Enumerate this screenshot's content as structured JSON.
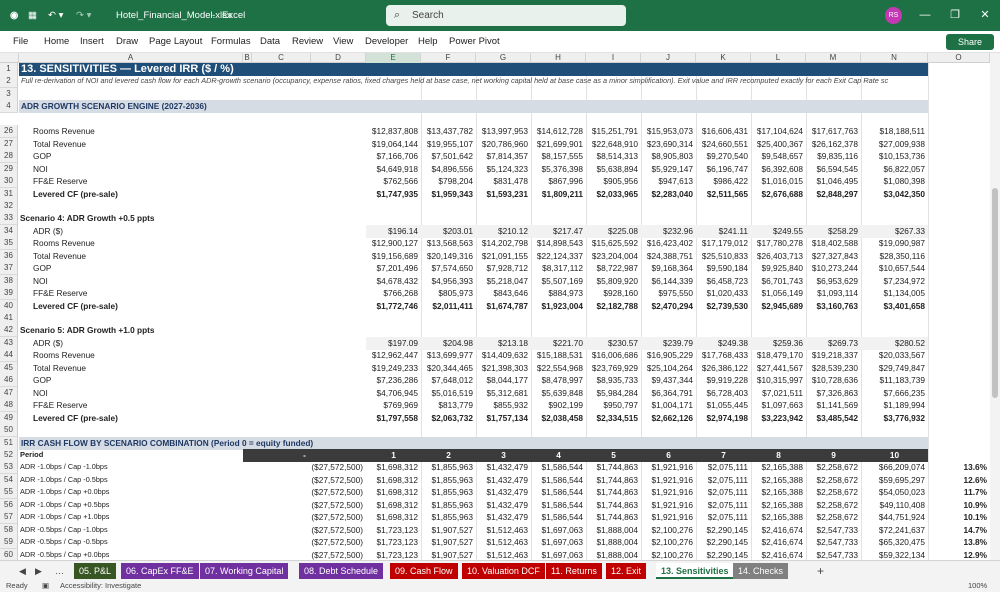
{
  "app": {
    "file_title": "Hotel_Financial_Model.xlsx",
    "app_name": "Excel",
    "search_placeholder": "Search",
    "avatar": "RS"
  },
  "menu": [
    "File",
    "Home",
    "Insert",
    "Draw",
    "Page Layout",
    "Formulas",
    "Data",
    "Review",
    "View",
    "Developer",
    "Help",
    "Power Pivot"
  ],
  "share_label": "Share",
  "columns": [
    "A",
    "B",
    "C",
    "D",
    "E",
    "F",
    "G",
    "H",
    "I",
    "J",
    "K",
    "L",
    "M",
    "N",
    "O"
  ],
  "sheet_title": "13. SENSITIVITIES — Levered IRR ($ / %)",
  "note": "Full re-derivation of NOI and levered cash flow for each ADR-growth scenario (occupancy, expense ratios, fixed charges held at base case, net working capital held at base case as a minor simplification). Exit value and IRR recomputed exactly for each Exit Cap Rate sc",
  "section1": "ADR GROWTH SCENARIO ENGINE (2027-2036)",
  "section2": "IRR CASH FLOW BY SCENARIO COMBINATION (Period 0 = equity funded)",
  "block1": [
    {
      "row": "26",
      "label": "Rooms Revenue",
      "vals": [
        "$12,837,808",
        "$13,437,782",
        "$13,997,953",
        "$14,612,728",
        "$15,251,791",
        "$15,953,073",
        "$16,606,431",
        "$17,104,624",
        "$17,617,763",
        "$18,188,511"
      ]
    },
    {
      "row": "27",
      "label": "Total Revenue",
      "vals": [
        "$19,064,144",
        "$19,955,107",
        "$20,786,960",
        "$21,699,901",
        "$22,648,910",
        "$23,690,314",
        "$24,660,551",
        "$25,400,367",
        "$26,162,378",
        "$27,009,938"
      ]
    },
    {
      "row": "28",
      "label": "GOP",
      "vals": [
        "$7,166,706",
        "$7,501,642",
        "$7,814,357",
        "$8,157,555",
        "$8,514,313",
        "$8,905,803",
        "$9,270,540",
        "$9,548,657",
        "$9,835,116",
        "$10,153,736"
      ]
    },
    {
      "row": "29",
      "label": "NOI",
      "vals": [
        "$4,649,918",
        "$4,896,556",
        "$5,124,323",
        "$5,376,398",
        "$5,638,894",
        "$5,929,147",
        "$6,196,747",
        "$6,392,608",
        "$6,594,545",
        "$6,822,057"
      ]
    },
    {
      "row": "30",
      "label": "FF&E Reserve",
      "vals": [
        "$762,566",
        "$798,204",
        "$831,478",
        "$867,996",
        "$905,956",
        "$947,613",
        "$986,422",
        "$1,016,015",
        "$1,046,495",
        "$1,080,398"
      ]
    },
    {
      "row": "31",
      "label": "Levered CF (pre-sale)",
      "bold": true,
      "vals": [
        "$1,747,935",
        "$1,959,343",
        "$1,593,231",
        "$1,809,211",
        "$2,033,965",
        "$2,283,040",
        "$2,511,565",
        "$2,676,688",
        "$2,848,297",
        "$3,042,350"
      ]
    }
  ],
  "scenario4": "Scenario 4: ADR Growth +0.5 ppts",
  "block2": [
    {
      "row": "34",
      "label": "ADR ($)",
      "input": true,
      "vals": [
        "$196.14",
        "$203.01",
        "$210.12",
        "$217.47",
        "$225.08",
        "$232.96",
        "$241.11",
        "$249.55",
        "$258.29",
        "$267.33"
      ]
    },
    {
      "row": "35",
      "label": "Rooms Revenue",
      "vals": [
        "$12,900,127",
        "$13,568,563",
        "$14,202,798",
        "$14,898,543",
        "$15,625,592",
        "$16,423,402",
        "$17,179,012",
        "$17,780,278",
        "$18,402,588",
        "$19,090,987"
      ]
    },
    {
      "row": "36",
      "label": "Total Revenue",
      "vals": [
        "$19,156,689",
        "$20,149,316",
        "$21,091,155",
        "$22,124,337",
        "$23,204,004",
        "$24,388,751",
        "$25,510,833",
        "$26,403,713",
        "$27,327,843",
        "$28,350,116"
      ]
    },
    {
      "row": "37",
      "label": "GOP",
      "vals": [
        "$7,201,496",
        "$7,574,650",
        "$7,928,712",
        "$8,317,112",
        "$8,722,987",
        "$9,168,364",
        "$9,590,184",
        "$9,925,840",
        "$10,273,244",
        "$10,657,544"
      ]
    },
    {
      "row": "38",
      "label": "NOI",
      "vals": [
        "$4,678,432",
        "$4,956,393",
        "$5,218,047",
        "$5,507,169",
        "$5,809,920",
        "$6,144,339",
        "$6,458,723",
        "$6,701,743",
        "$6,953,629",
        "$7,234,972"
      ]
    },
    {
      "row": "39",
      "label": "FF&E Reserve",
      "vals": [
        "$766,268",
        "$805,973",
        "$843,646",
        "$884,973",
        "$928,160",
        "$975,550",
        "$1,020,433",
        "$1,056,149",
        "$1,093,114",
        "$1,134,005"
      ]
    },
    {
      "row": "40",
      "label": "Levered CF (pre-sale)",
      "bold": true,
      "vals": [
        "$1,772,746",
        "$2,011,411",
        "$1,674,787",
        "$1,923,004",
        "$2,182,788",
        "$2,470,294",
        "$2,739,530",
        "$2,945,689",
        "$3,160,763",
        "$3,401,658"
      ]
    }
  ],
  "scenario5": "Scenario 5: ADR Growth +1.0 ppts",
  "block3": [
    {
      "row": "43",
      "label": "ADR ($)",
      "input": true,
      "vals": [
        "$197.09",
        "$204.98",
        "$213.18",
        "$221.70",
        "$230.57",
        "$239.79",
        "$249.38",
        "$259.36",
        "$269.73",
        "$280.52"
      ]
    },
    {
      "row": "44",
      "label": "Rooms Revenue",
      "vals": [
        "$12,962,447",
        "$13,699,977",
        "$14,409,632",
        "$15,188,531",
        "$16,006,686",
        "$16,905,229",
        "$17,768,433",
        "$18,479,170",
        "$19,218,337",
        "$20,033,567"
      ]
    },
    {
      "row": "45",
      "label": "Total Revenue",
      "vals": [
        "$19,249,233",
        "$20,344,465",
        "$21,398,303",
        "$22,554,968",
        "$23,769,929",
        "$25,104,264",
        "$26,386,122",
        "$27,441,567",
        "$28,539,230",
        "$29,749,847"
      ]
    },
    {
      "row": "46",
      "label": "GOP",
      "vals": [
        "$7,236,286",
        "$7,648,012",
        "$8,044,177",
        "$8,478,997",
        "$8,935,733",
        "$9,437,344",
        "$9,919,228",
        "$10,315,997",
        "$10,728,636",
        "$11,183,739"
      ]
    },
    {
      "row": "47",
      "label": "NOI",
      "vals": [
        "$4,706,945",
        "$5,016,519",
        "$5,312,681",
        "$5,639,848",
        "$5,984,284",
        "$6,364,791",
        "$6,728,403",
        "$7,021,511",
        "$7,326,863",
        "$7,666,235"
      ]
    },
    {
      "row": "48",
      "label": "FF&E Reserve",
      "vals": [
        "$769,969",
        "$813,779",
        "$855,932",
        "$902,199",
        "$950,797",
        "$1,004,171",
        "$1,055,445",
        "$1,097,663",
        "$1,141,569",
        "$1,189,994"
      ]
    },
    {
      "row": "49",
      "label": "Levered CF (pre-sale)",
      "bold": true,
      "vals": [
        "$1,797,558",
        "$2,063,732",
        "$1,757,134",
        "$2,038,458",
        "$2,334,515",
        "$2,662,126",
        "$2,974,198",
        "$3,223,942",
        "$3,485,542",
        "$3,776,932"
      ]
    }
  ],
  "irr_header": {
    "label": "Period",
    "periods": [
      "-",
      "1",
      "2",
      "3",
      "4",
      "5",
      "6",
      "7",
      "8",
      "9",
      "10"
    ]
  },
  "irr_rows": [
    {
      "row": "53",
      "label": "ADR -1.0bps / Cap -1.0bps",
      "vals": [
        "($27,572,500)",
        "$1,698,312",
        "$1,855,963",
        "$1,432,479",
        "$1,586,544",
        "$1,744,863",
        "$1,921,916",
        "$2,075,111",
        "$2,165,388",
        "$2,258,672",
        "$66,209,074"
      ],
      "irr": "13.6%"
    },
    {
      "row": "54",
      "label": "ADR -1.0bps / Cap -0.5bps",
      "vals": [
        "($27,572,500)",
        "$1,698,312",
        "$1,855,963",
        "$1,432,479",
        "$1,586,544",
        "$1,744,863",
        "$1,921,916",
        "$2,075,111",
        "$2,165,388",
        "$2,258,672",
        "$59,695,297"
      ],
      "irr": "12.6%"
    },
    {
      "row": "55",
      "label": "ADR -1.0bps / Cap +0.0bps",
      "vals": [
        "($27,572,500)",
        "$1,698,312",
        "$1,855,963",
        "$1,432,479",
        "$1,586,544",
        "$1,744,863",
        "$1,921,916",
        "$2,075,111",
        "$2,165,388",
        "$2,258,672",
        "$54,050,023"
      ],
      "irr": "11.7%"
    },
    {
      "row": "56",
      "label": "ADR -1.0bps / Cap +0.5bps",
      "vals": [
        "($27,572,500)",
        "$1,698,312",
        "$1,855,963",
        "$1,432,479",
        "$1,586,544",
        "$1,744,863",
        "$1,921,916",
        "$2,075,111",
        "$2,165,388",
        "$2,258,672",
        "$49,110,408"
      ],
      "irr": "10.9%"
    },
    {
      "row": "57",
      "label": "ADR -1.0bps / Cap +1.0bps",
      "vals": [
        "($27,572,500)",
        "$1,698,312",
        "$1,855,963",
        "$1,432,479",
        "$1,586,544",
        "$1,744,863",
        "$1,921,916",
        "$2,075,111",
        "$2,165,388",
        "$2,258,672",
        "$44,751,924"
      ],
      "irr": "10.1%"
    },
    {
      "row": "58",
      "label": "ADR -0.5bps / Cap -1.0bps",
      "vals": [
        "($27,572,500)",
        "$1,723,123",
        "$1,907,527",
        "$1,512,463",
        "$1,697,063",
        "$1,888,004",
        "$2,100,276",
        "$2,290,145",
        "$2,416,674",
        "$2,547,733",
        "$72,241,637"
      ],
      "irr": "14.7%"
    },
    {
      "row": "59",
      "label": "ADR -0.5bps / Cap -0.5bps",
      "vals": [
        "($27,572,500)",
        "$1,723,123",
        "$1,907,527",
        "$1,512,463",
        "$1,697,063",
        "$1,888,004",
        "$2,100,276",
        "$2,290,145",
        "$2,416,674",
        "$2,547,733",
        "$65,320,475"
      ],
      "irr": "13.8%"
    },
    {
      "row": "60",
      "label": "ADR -0.5bps / Cap +0.0bps",
      "vals": [
        "($27,572,500)",
        "$1,723,123",
        "$1,907,527",
        "$1,512,463",
        "$1,697,063",
        "$1,888,004",
        "$2,100,276",
        "$2,290,145",
        "$2,416,674",
        "$2,547,733",
        "$59,322,134"
      ],
      "irr": "12.9%"
    }
  ],
  "tabs": [
    {
      "label": "05. P&L",
      "color": "#375623"
    },
    {
      "label": "06. CapEx FF&E",
      "color": "#7030a0"
    },
    {
      "label": "07. Working Capital",
      "color": "#7030a0"
    },
    {
      "label": "08. Debt Schedule",
      "color": "#7030a0"
    },
    {
      "label": "09. Cash Flow",
      "color": "#c00000"
    },
    {
      "label": "10. Valuation DCF",
      "color": "#c00000"
    },
    {
      "label": "11. Returns",
      "color": "#c00000"
    },
    {
      "label": "12. Exit",
      "color": "#c00000"
    },
    {
      "label": "13. Sensitivities",
      "color": "#ffffff",
      "active": true
    },
    {
      "label": "14. Checks",
      "color": "#808080"
    }
  ],
  "status": {
    "ready": "Ready",
    "accessibility": "Accessibility: Investigate",
    "zoom": "100%"
  }
}
